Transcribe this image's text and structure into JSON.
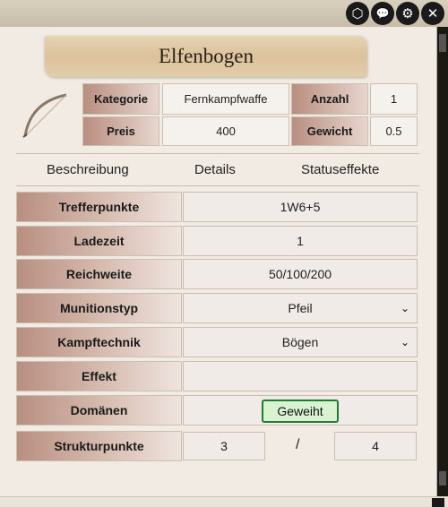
{
  "window": {
    "controls": [
      {
        "icon": "d20-icon",
        "glyph": "⬡"
      },
      {
        "icon": "chat-icon",
        "glyph": "💬"
      },
      {
        "icon": "gear-icon",
        "glyph": "⚙"
      },
      {
        "icon": "close-icon",
        "glyph": "✕"
      }
    ]
  },
  "item": {
    "name": "Elfenbogen",
    "icon": "bow-icon"
  },
  "stats": {
    "kategorie_label": "Kategorie",
    "kategorie_value": "Fernkampfwaffe",
    "anzahl_label": "Anzahl",
    "anzahl_value": "1",
    "preis_label": "Preis",
    "preis_value": "400",
    "gewicht_label": "Gewicht",
    "gewicht_value": "0.5"
  },
  "tabs": {
    "beschreibung": "Beschreibung",
    "details": "Details",
    "statuseffekte": "Statuseffekte"
  },
  "details": {
    "trefferpunkte_label": "Trefferpunkte",
    "trefferpunkte_value": "1W6+5",
    "ladezeit_label": "Ladezeit",
    "ladezeit_value": "1",
    "reichweite_label": "Reichweite",
    "reichweite_value": "50/100/200",
    "munitionstyp_label": "Munitionstyp",
    "munitionstyp_value": "Pfeil",
    "kampftechnik_label": "Kampftechnik",
    "kampftechnik_value": "Bögen",
    "effekt_label": "Effekt",
    "effekt_value": "",
    "domaenen_label": "Domänen",
    "domaenen_tag": "Geweiht",
    "strukturpunkte_label": "Strukturpunkte",
    "strukturpunkte_current": "3",
    "strukturpunkte_separator": "/",
    "strukturpunkte_max": "4"
  },
  "colors": {
    "label_accent": "#b88f80",
    "tag_border": "#1f7b34",
    "tag_fill": "#d9f3d1",
    "banner": "#dbc29c"
  }
}
